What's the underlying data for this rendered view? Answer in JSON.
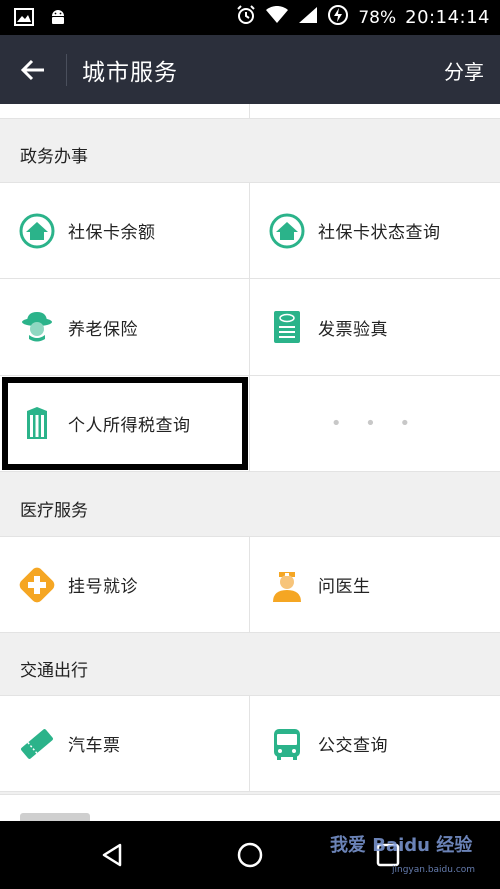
{
  "status_bar": {
    "battery": "78%",
    "time": "20:14:14"
  },
  "toolbar": {
    "title": "城市服务",
    "share": "分享"
  },
  "sections": {
    "gov": {
      "title": "政务办事",
      "items": [
        {
          "label": "社保卡余额",
          "icon": "social-card-house-icon"
        },
        {
          "label": "社保卡状态查询",
          "icon": "social-card-house-icon"
        },
        {
          "label": "养老保险",
          "icon": "elder-person-icon"
        },
        {
          "label": "发票验真",
          "icon": "invoice-receipt-icon"
        },
        {
          "label": "个人所得税查询",
          "icon": "tax-building-icon"
        },
        {
          "label": "• • •",
          "icon": "more-dots-icon"
        }
      ]
    },
    "medical": {
      "title": "医疗服务",
      "items": [
        {
          "label": "挂号就诊",
          "icon": "medical-cross-icon"
        },
        {
          "label": "问医生",
          "icon": "doctor-icon"
        }
      ]
    },
    "traffic": {
      "title": "交通出行",
      "items": [
        {
          "label": "汽车票",
          "icon": "ticket-icon"
        },
        {
          "label": "公交查询",
          "icon": "bus-icon"
        }
      ]
    }
  },
  "watermark": {
    "main": "我爱 Baidu 经验",
    "url": "jingyan.baidu.com"
  },
  "colors": {
    "green": "#2bb38a",
    "orange": "#f5a623",
    "toolbar": "#2b2f3b"
  }
}
